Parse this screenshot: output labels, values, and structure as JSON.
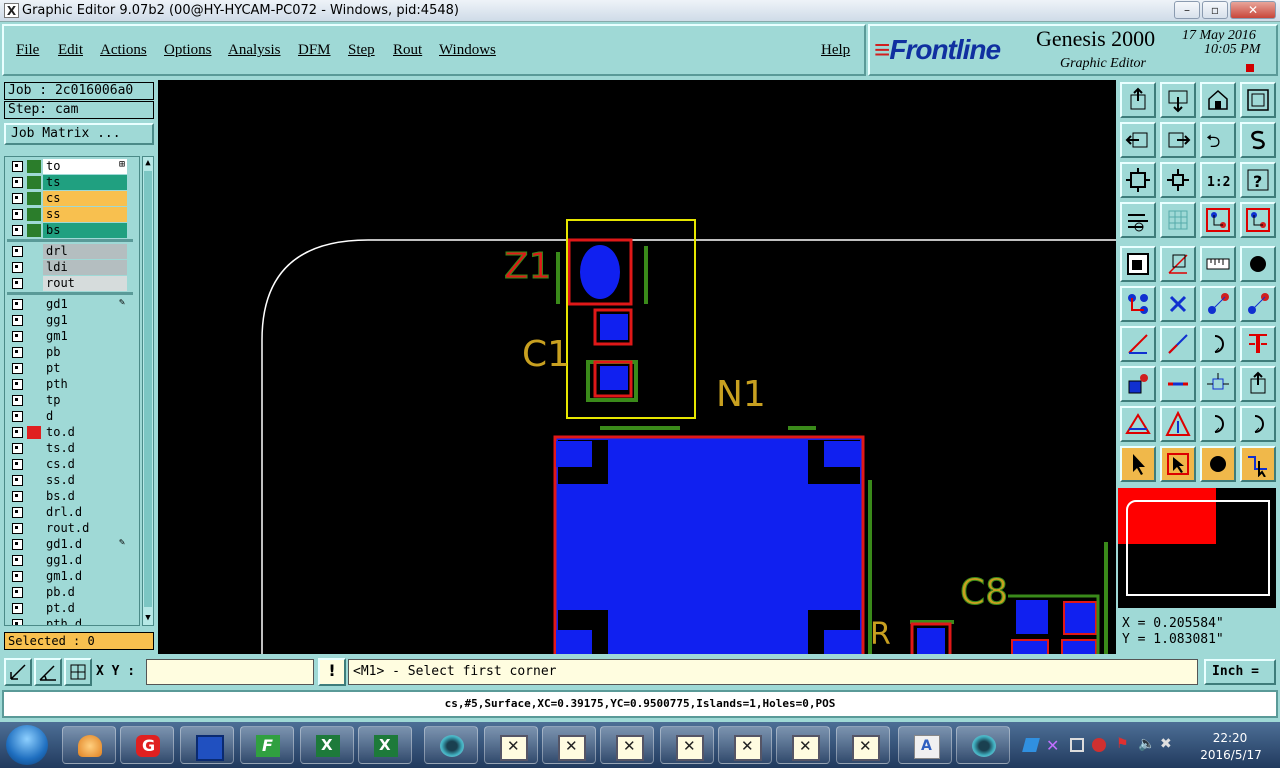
{
  "window": {
    "title": "Graphic Editor 9.07b2 (00@HY-HYCAM-PC072 - Windows, pid:4548)",
    "controls": {
      "minimize": "–",
      "maximize": "▫",
      "close": "✕"
    }
  },
  "menu": [
    "File",
    "Edit",
    "Actions",
    "Options",
    "Analysis",
    "DFM",
    "Step",
    "Rout",
    "Windows",
    "Help"
  ],
  "brand": {
    "logo": "Frontline",
    "product": "Genesis 2000",
    "subtitle": "Graphic Editor",
    "date": "17 May 2016",
    "time": "10:05 PM"
  },
  "job": {
    "job_label": "Job : 2c016006a0",
    "step_label": "Step: cam",
    "matrix_button": "Job Matrix ..."
  },
  "layers": [
    {
      "name": "to",
      "color": "#2b7d2b",
      "bg": "#ffffff",
      "mark": "⊞"
    },
    {
      "name": "ts",
      "color": "#2b7d2b",
      "bg": "#20a080"
    },
    {
      "name": "cs",
      "color": "#2b7d2b",
      "bg": "#f8c04f"
    },
    {
      "name": "ss",
      "color": "#2b7d2b",
      "bg": "#f8c04f"
    },
    {
      "name": "bs",
      "color": "#2b7d2b",
      "bg": "#20a080"
    },
    {
      "name": "drl",
      "color": "",
      "bg": "#b4bec0",
      "sep": true
    },
    {
      "name": "ldi",
      "color": "",
      "bg": "#b4bec0"
    },
    {
      "name": "rout",
      "color": "",
      "bg": "#d6dcdc"
    },
    {
      "name": "gd1",
      "color": "",
      "bg": "#9fd9d6",
      "sep": true,
      "mark": "✎"
    },
    {
      "name": "gg1",
      "color": "",
      "bg": "#9fd9d6"
    },
    {
      "name": "gm1",
      "color": "",
      "bg": "#9fd9d6"
    },
    {
      "name": "pb",
      "color": "",
      "bg": "#9fd9d6"
    },
    {
      "name": "pt",
      "color": "",
      "bg": "#9fd9d6"
    },
    {
      "name": "pth",
      "color": "",
      "bg": "#9fd9d6"
    },
    {
      "name": "tp",
      "color": "",
      "bg": "#9fd9d6"
    },
    {
      "name": "d",
      "color": "",
      "bg": "#9fd9d6"
    },
    {
      "name": "to.d",
      "color": "#e02020",
      "bg": "#9fd9d6"
    },
    {
      "name": "ts.d",
      "color": "",
      "bg": "#9fd9d6"
    },
    {
      "name": "cs.d",
      "color": "",
      "bg": "#9fd9d6"
    },
    {
      "name": "ss.d",
      "color": "",
      "bg": "#9fd9d6"
    },
    {
      "name": "bs.d",
      "color": "",
      "bg": "#9fd9d6"
    },
    {
      "name": "drl.d",
      "color": "",
      "bg": "#9fd9d6"
    },
    {
      "name": "rout.d",
      "color": "",
      "bg": "#9fd9d6"
    },
    {
      "name": "gd1.d",
      "color": "",
      "bg": "#9fd9d6",
      "mark": "✎"
    },
    {
      "name": "gg1.d",
      "color": "",
      "bg": "#9fd9d6"
    },
    {
      "name": "gm1.d",
      "color": "",
      "bg": "#9fd9d6"
    },
    {
      "name": "pb.d",
      "color": "",
      "bg": "#9fd9d6"
    },
    {
      "name": "pt.d",
      "color": "",
      "bg": "#9fd9d6"
    },
    {
      "name": "pth.d",
      "color": "",
      "bg": "#9fd9d6"
    }
  ],
  "selected_label": "Selected : 0",
  "canvas": {
    "ref_labels": {
      "z1": "Z1",
      "c1": "C1",
      "n1": "N1",
      "c8": "C8",
      "r_partial": "R"
    }
  },
  "tools": [
    "up-icon",
    "down-icon",
    "home-icon",
    "window-icon",
    "left-icon",
    "right-icon",
    "back-icon",
    "snap-icon",
    "zoom-fit-icon",
    "zoom-center-icon",
    "scale-1-2-icon",
    "help-icon",
    "layers-icon",
    "grid-icon",
    "pads-icon",
    "pads-red-icon",
    "select-square-icon",
    "rotate-icon",
    "measure-icon",
    "circle-icon",
    "connect-icon",
    "cross-icon",
    "move-dot-icon",
    "move-dot2-icon",
    "line-icon",
    "line2-icon",
    "arc-icon",
    "mirror-icon",
    "pad-add-icon",
    "line-minus-icon",
    "resize-icon",
    "pad-group-icon",
    "triangle-icon",
    "triangle2-icon",
    "arch-icon",
    "arch2-icon",
    "pointer-icon",
    "pointer-box-icon",
    "pointer-circle-icon",
    "route-icon"
  ],
  "coords": {
    "x": "X = 0.205584\"",
    "y": "Y = 1.083081\""
  },
  "command": {
    "xy_label": "X Y :",
    "xy_value": "",
    "warn": "!",
    "prompt": "<M1> - Select first corner",
    "unit": "Inch ="
  },
  "status": "cs,#5,Surface,XC=0.39175,YC=0.9500775,Islands=1,Holes=0,POS",
  "taskbar": {
    "apps": [
      "seashell-icon",
      "grammar-icon",
      "save-disk-icon",
      "frontline-icon",
      "excel-icon",
      "excel-icon",
      "eye-icon",
      "genesis-window-icon",
      "genesis-window-icon",
      "genesis-window-icon",
      "genesis-window-icon",
      "genesis-window-icon",
      "genesis-window-icon",
      "genesis-window-icon",
      "document-icon",
      "eye-icon"
    ],
    "time": "22:20",
    "date": "2016/5/17"
  }
}
